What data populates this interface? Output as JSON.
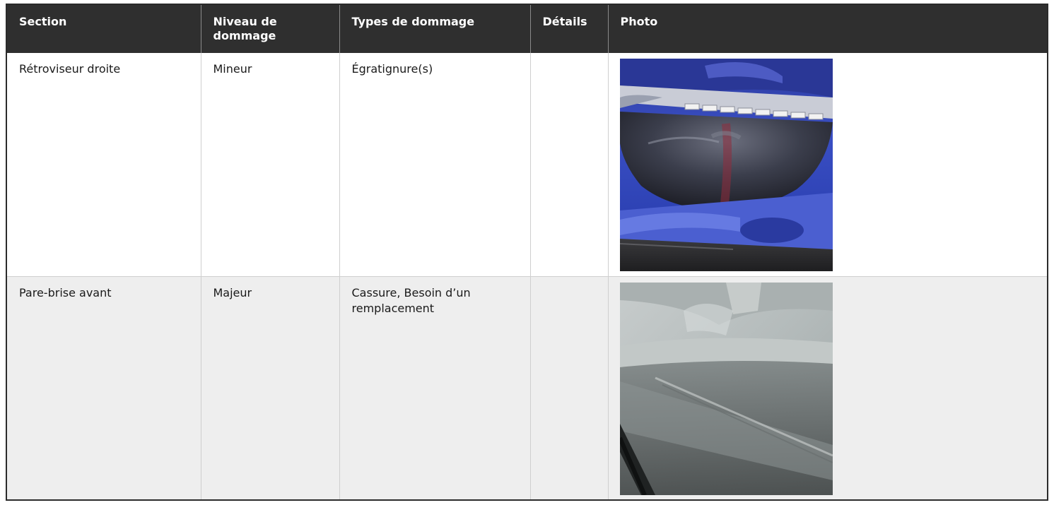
{
  "headers": {
    "section": "Section",
    "level": "Niveau de dommage",
    "types": "Types de dommage",
    "details": "Détails",
    "photo": "Photo"
  },
  "rows": [
    {
      "section": "Rétroviseur droite",
      "level": "Mineur",
      "types": "Égratignure(s)",
      "details": "",
      "photo": "side-mirror-photo"
    },
    {
      "section": "Pare-brise avant",
      "level": "Majeur",
      "types": "Cassure, Besoin d’un remplacement",
      "details": "",
      "photo": "windshield-photo"
    }
  ],
  "colors": {
    "header_bg": "#2f2f2f",
    "header_text": "#ffffff",
    "row_alt_bg": "#eeeeee",
    "border": "#2b2b2b"
  }
}
